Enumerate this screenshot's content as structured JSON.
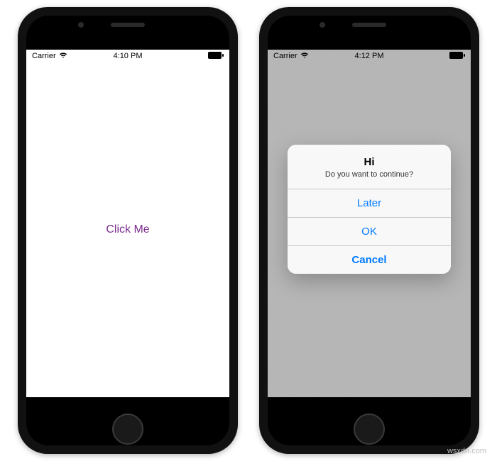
{
  "phone1": {
    "status": {
      "carrier": "Carrier",
      "time": "4:10 PM"
    },
    "button_label": "Click Me"
  },
  "phone2": {
    "status": {
      "carrier": "Carrier",
      "time": "4:12 PM"
    },
    "alert": {
      "title": "Hi",
      "message": "Do you want to continue?",
      "actions": {
        "later": "Later",
        "ok": "OK",
        "cancel": "Cancel"
      }
    }
  },
  "watermark": "wsxdn.com"
}
